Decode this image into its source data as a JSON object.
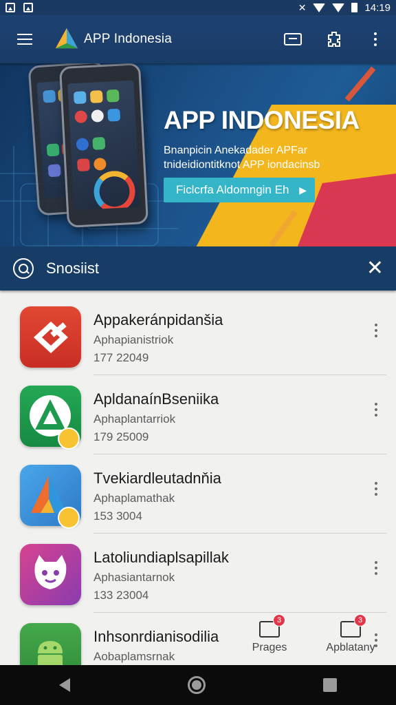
{
  "status_bar": {
    "time": "14:19"
  },
  "app_bar": {
    "title": "APP Indonesia",
    "icons": [
      "menu-icon",
      "cast-icon",
      "puzzle-icon",
      "more-vert-icon"
    ]
  },
  "banner": {
    "title": "APP INDONESIA",
    "subtitle_line1": "Bnanpicin Anekadader APFar",
    "subtitle_line2": "tnideidiontitknot APP iondacinsb",
    "button_label": "Ficlcrfa Aldomngin Eh"
  },
  "search": {
    "query": "Snosiist"
  },
  "apps": [
    {
      "name": "Appakeránpidanšia",
      "developer": "Aphapianistriok",
      "count": "177 22049",
      "icon": "red-app-icon",
      "color": "#d7382c"
    },
    {
      "name": "ApldanaínBseniika",
      "developer": "Aphaplantarriok",
      "count": "179 25009",
      "icon": "green-a-app-icon",
      "color": "#1e9a4e"
    },
    {
      "name": "Tvekiardleutadnňia",
      "developer": "Aphaplamathak",
      "count": "153 3004",
      "icon": "blue-a-app-icon",
      "color": "#3a8fd6"
    },
    {
      "name": "Latoliundiaplsapillak",
      "developer": "Aphasiantarnok",
      "count": "133 23004",
      "icon": "purple-face-app-icon",
      "color": "#c03a8f"
    },
    {
      "name": "Inhsonrdianisodilia",
      "developer": "Aobaplamsrnak",
      "count": "",
      "icon": "android-app-icon",
      "color": "#3d9a43"
    }
  ],
  "bottom_nav": {
    "pages_label": "Prages",
    "pages_count": "3",
    "apps_label": "Apblatany",
    "apps_count": "3"
  }
}
